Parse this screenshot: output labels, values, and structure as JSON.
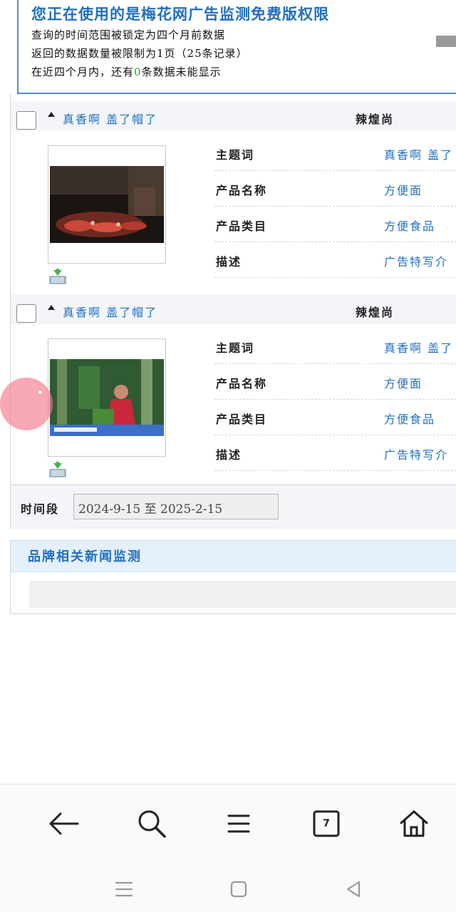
{
  "notice": {
    "title": "您正在使用的是梅花网广告监测免费版权限",
    "line1": "查询的时间范围被锁定为四个月前数据",
    "line2": "返回的数据数量被限制为1页（25条记录）",
    "line3_prefix": "在近四个月内，还有",
    "line3_count": "0",
    "line3_suffix": "条数据未能显示"
  },
  "ads": [
    {
      "title": "真香啊 盖了帽了",
      "brand": "辣煌尚",
      "attributes": [
        {
          "key": "主题词",
          "value": "真香啊 盖了"
        },
        {
          "key": "产品名称",
          "value": "方便面"
        },
        {
          "key": "产品类目",
          "value": "方便食品"
        },
        {
          "key": "描述",
          "value": "广告特写介"
        }
      ]
    },
    {
      "title": "真香啊 盖了帽了",
      "brand": "辣煌尚",
      "attributes": [
        {
          "key": "主题词",
          "value": "真香啊 盖了"
        },
        {
          "key": "产品名称",
          "value": "方便面"
        },
        {
          "key": "产品类目",
          "value": "方便食品"
        },
        {
          "key": "描述",
          "value": "广告特写介"
        }
      ]
    }
  ],
  "time_filter": {
    "label": "时间段",
    "value": "2024-9-15 至 2025-2-15"
  },
  "news": {
    "title": "品牌相关新闻监测"
  },
  "browser": {
    "tab_count": "7"
  }
}
